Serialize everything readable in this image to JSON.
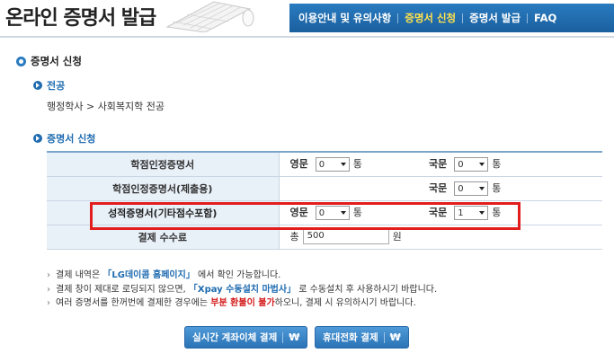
{
  "header": {
    "title": "온라인 증명서 발급",
    "nav": [
      {
        "label": "이용안내 및 유의사항",
        "active": false
      },
      {
        "label": "증명서 신청",
        "active": true
      },
      {
        "label": "증명서 발급",
        "active": false
      },
      {
        "label": "FAQ",
        "active": false
      }
    ]
  },
  "section": {
    "title": "증명서 신청",
    "major_heading": "전공",
    "major_value": "행정학사 > 사회복지학 전공",
    "apply_heading": "증명서 신청"
  },
  "table": {
    "eng_label": "영문",
    "kor_label": "국문",
    "unit": "통",
    "rows": [
      {
        "name": "학점인정증명서",
        "eng": "0",
        "kor": "0"
      },
      {
        "name": "학점인정증명서(제출용)",
        "eng": null,
        "kor": "0"
      },
      {
        "name": "성적증명서(기타점수포함)",
        "eng": "0",
        "kor": "1"
      }
    ],
    "fee": {
      "name": "결제 수수료",
      "prefix": "총",
      "value": "500",
      "unit": "원"
    }
  },
  "notes": [
    {
      "pre": "결제 내역은 ",
      "hl": "「LG데이콤 홈페이지」",
      "post": " 에서 확인 가능합니다."
    },
    {
      "pre": "결제 창이 제대로 로딩되지 않으면, ",
      "hl": "「Xpay 수동설치 마법사」",
      "post": " 로 수동설치 후 사용하시기 바랍니다."
    },
    {
      "pre": "여러 증명서를 한꺼번에 결제한 경우에는 ",
      "hl": "부분 환불이 불가",
      "post": "하오니, 결제 시 유의하시기 바랍니다."
    }
  ],
  "buttons": {
    "account_transfer": "실시간 계좌이체 결제",
    "mobile": "휴대전화 결제",
    "won_symbol": "₩"
  },
  "colors": {
    "nav_bg": "#1a5f9e",
    "nav_active": "#ffe14d",
    "accent_blue": "#1e6bb0",
    "highlight_red": "#e21d1d",
    "warning_red": "#d41a1a"
  }
}
